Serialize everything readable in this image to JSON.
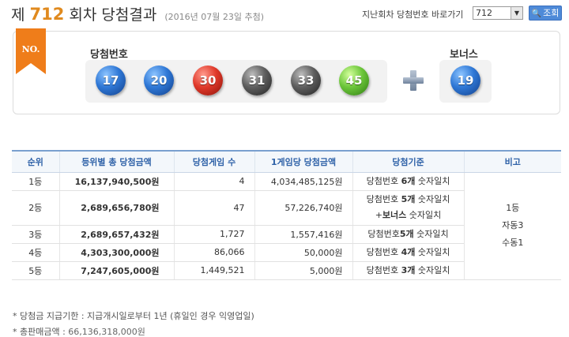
{
  "header": {
    "prefix": "제",
    "round": "712",
    "suffix": "회차 당첨결과",
    "date": "(2016년 07월 23일 추첨)",
    "jump_label": "지난회차 당첨번호 바로가기",
    "selected_round": "712",
    "search_button": "조회"
  },
  "winning": {
    "badge": "NO.",
    "numbers_label": "당첨번호",
    "bonus_label": "보너스",
    "numbers": [
      {
        "value": "17",
        "color": "blue"
      },
      {
        "value": "20",
        "color": "blue"
      },
      {
        "value": "30",
        "color": "red"
      },
      {
        "value": "31",
        "color": "gray"
      },
      {
        "value": "33",
        "color": "gray"
      },
      {
        "value": "45",
        "color": "green"
      }
    ],
    "bonus": {
      "value": "19",
      "color": "blue"
    }
  },
  "table": {
    "headers": [
      "순위",
      "등위별 총 당첨금액",
      "당첨게임 수",
      "1게임당 당첨금액",
      "당첨기준",
      "비고"
    ],
    "rows": [
      {
        "rank": "1등",
        "total": "16,137,940,500원",
        "count": "4",
        "each": "4,034,485,125원",
        "crit_a": "당첨번호 ",
        "crit_b": "6개",
        "crit_c": " 숫자일치",
        "crit2_a": "",
        "crit2_b": "",
        "crit2_c": ""
      },
      {
        "rank": "2등",
        "total": "2,689,656,780원",
        "count": "47",
        "each": "57,226,740원",
        "crit_a": "당첨번호 ",
        "crit_b": "5개",
        "crit_c": " 숫자일치",
        "crit2_a": "+",
        "crit2_b": "보너스",
        "crit2_c": " 숫자일치"
      },
      {
        "rank": "3등",
        "total": "2,689,657,432원",
        "count": "1,727",
        "each": "1,557,416원",
        "crit_a": "당첨번호",
        "crit_b": "5개",
        "crit_c": " 숫자일치",
        "crit2_a": "",
        "crit2_b": "",
        "crit2_c": ""
      },
      {
        "rank": "4등",
        "total": "4,303,300,000원",
        "count": "86,066",
        "each": "50,000원",
        "crit_a": "당첨번호 ",
        "crit_b": "4개",
        "crit_c": " 숫자일치",
        "crit2_a": "",
        "crit2_b": "",
        "crit2_c": ""
      },
      {
        "rank": "5등",
        "total": "7,247,605,000원",
        "count": "1,449,521",
        "each": "5,000원",
        "crit_a": "당첨번호 ",
        "crit_b": "3개",
        "crit_c": " 숫자일치",
        "crit2_a": "",
        "crit2_b": "",
        "crit2_c": ""
      }
    ],
    "note_lines": [
      "1등",
      "자동3",
      "수동1"
    ]
  },
  "footer": {
    "deadline": "* 당첨금 지급기한 : 지급개시일로부터 1년 (휴일인 경우 익영업일)",
    "sales_label": "* 총판매금액 : ",
    "sales_amount": "66,136,318,000원"
  },
  "colors": {
    "accent_orange": "#e08a1e",
    "header_blue": "#2f62a8",
    "button_blue": "#4e8ad8"
  }
}
